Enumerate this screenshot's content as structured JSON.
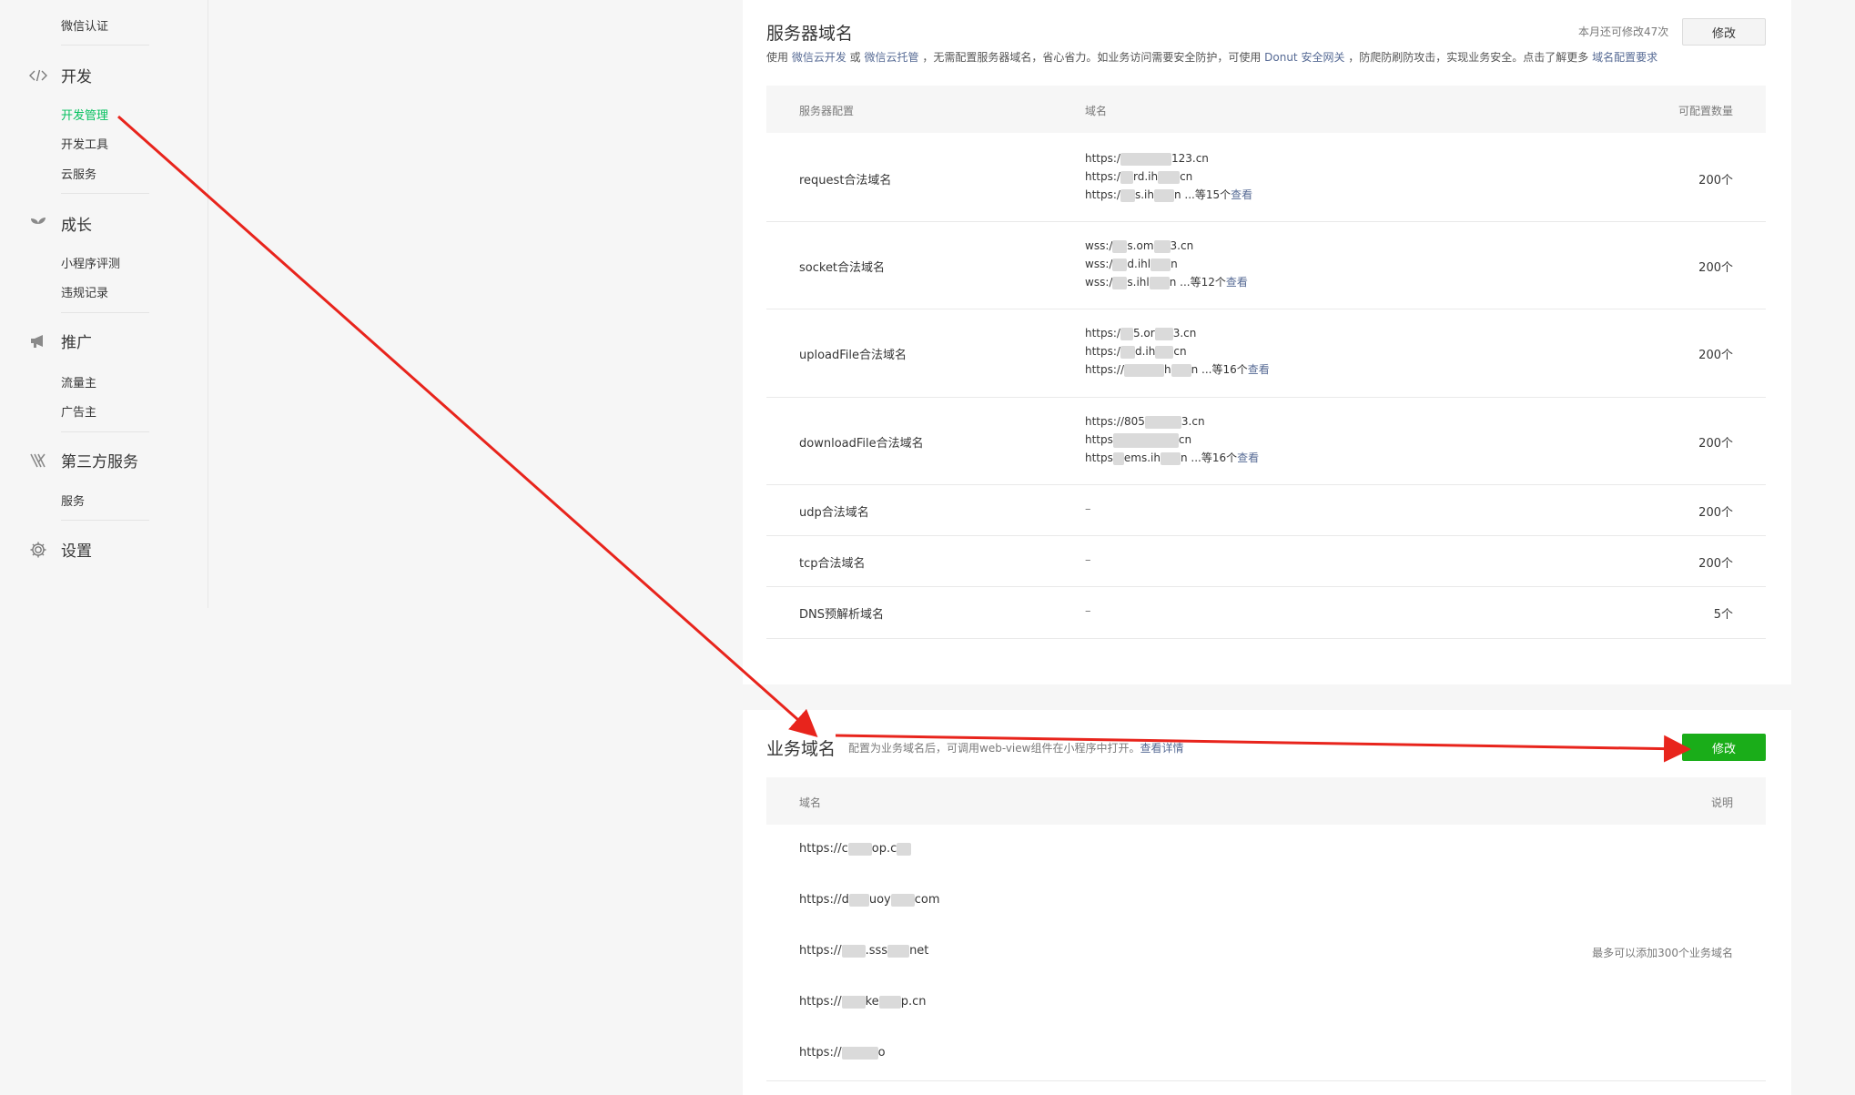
{
  "sidebar": {
    "wechat_verify": "微信认证",
    "dev": {
      "label": "开发",
      "items": [
        "开发管理",
        "开发工具",
        "云服务"
      ]
    },
    "growth": {
      "label": "成长",
      "items": [
        "小程序评测",
        "违规记录"
      ]
    },
    "promo": {
      "label": "推广",
      "items": [
        "流量主",
        "广告主"
      ]
    },
    "third": {
      "label": "第三方服务",
      "items": [
        "服务"
      ]
    },
    "settings": {
      "label": "设置"
    }
  },
  "server_domain": {
    "title": "服务器域名",
    "quota": "本月还可修改47次",
    "modify_label": "修改",
    "desc": {
      "p1": "使用 ",
      "l1": "微信云开发",
      "p2": " 或 ",
      "l2": "微信云托管",
      "p3": " ，无需配置服务器域名，省心省力。如业务访问需要安全防护，可使用 ",
      "l3": "Donut 安全网关",
      "p4": " ，防爬防刷防攻击，实现业务安全。点击了解更多 ",
      "l4": "域名配置要求"
    },
    "headers": {
      "config": "服务器配置",
      "domain": "域名",
      "count": "可配置数量"
    },
    "view_label": "查看",
    "rows": [
      {
        "name": "request合法域名",
        "d1a": "https:/",
        "d1b": "123.cn",
        "d2a": "https:/",
        "d2b": "rd.ih",
        "d2c": "cn",
        "d3a": "https:/",
        "d3b": "s.ih",
        "d3c": "n ...等15个",
        "count": "200个"
      },
      {
        "name": "socket合法域名",
        "d1a": "wss:/",
        "d1b": "s.om",
        "d1c": "3.cn",
        "d2a": "wss:/",
        "d2b": "d.ihl",
        "d2c": "n",
        "d3a": "wss:/",
        "d3b": "s.ihl",
        "d3c": "n ...等12个",
        "count": "200个"
      },
      {
        "name": "uploadFile合法域名",
        "d1a": "https:/",
        "d1b": "5.or",
        "d1c": "3.cn",
        "d2a": "https:/",
        "d2b": "d.ih",
        "d2c": "cn",
        "d3a": "https://",
        "d3b": "h",
        "d3c": "n ...等16个",
        "count": "200个"
      },
      {
        "name": "downloadFile合法域名",
        "d1a": "https://805",
        "d1b": "",
        "d1c": "3.cn",
        "d2a": "https",
        "d2b": "",
        "d2c": "cn",
        "d3a": "https",
        "d3b": "ems.ih",
        "d3c": "n ...等16个",
        "count": "200个"
      },
      {
        "name": "udp合法域名",
        "dash": "–",
        "count": "200个"
      },
      {
        "name": "tcp合法域名",
        "dash": "–",
        "count": "200个"
      },
      {
        "name": "DNS预解析域名",
        "dash": "–",
        "count": "5个"
      }
    ]
  },
  "biz_domain": {
    "title": "业务域名",
    "desc": "配置为业务域名后，可调用web-view组件在小程序中打开。",
    "desc_link": "查看详情",
    "modify_label": "修改",
    "headers": {
      "domain": "域名",
      "note": "说明"
    },
    "rows": [
      {
        "a": "https://c",
        "b": "op.c",
        "c": ""
      },
      {
        "a": "https://d",
        "b": "uoy",
        "c": "com"
      },
      {
        "a": "https://",
        "b": ".sss",
        "c": "net"
      },
      {
        "a": "https://",
        "b": "ke",
        "c": "p.cn"
      },
      {
        "a": "https://",
        "b": "",
        "c": "o"
      }
    ],
    "note": "最多可以添加300个业务域名"
  },
  "colors": {
    "accent_green": "#07c160",
    "button_green": "#1aad19",
    "link_blue": "#576b95",
    "arrow_red": "#e8241c"
  }
}
